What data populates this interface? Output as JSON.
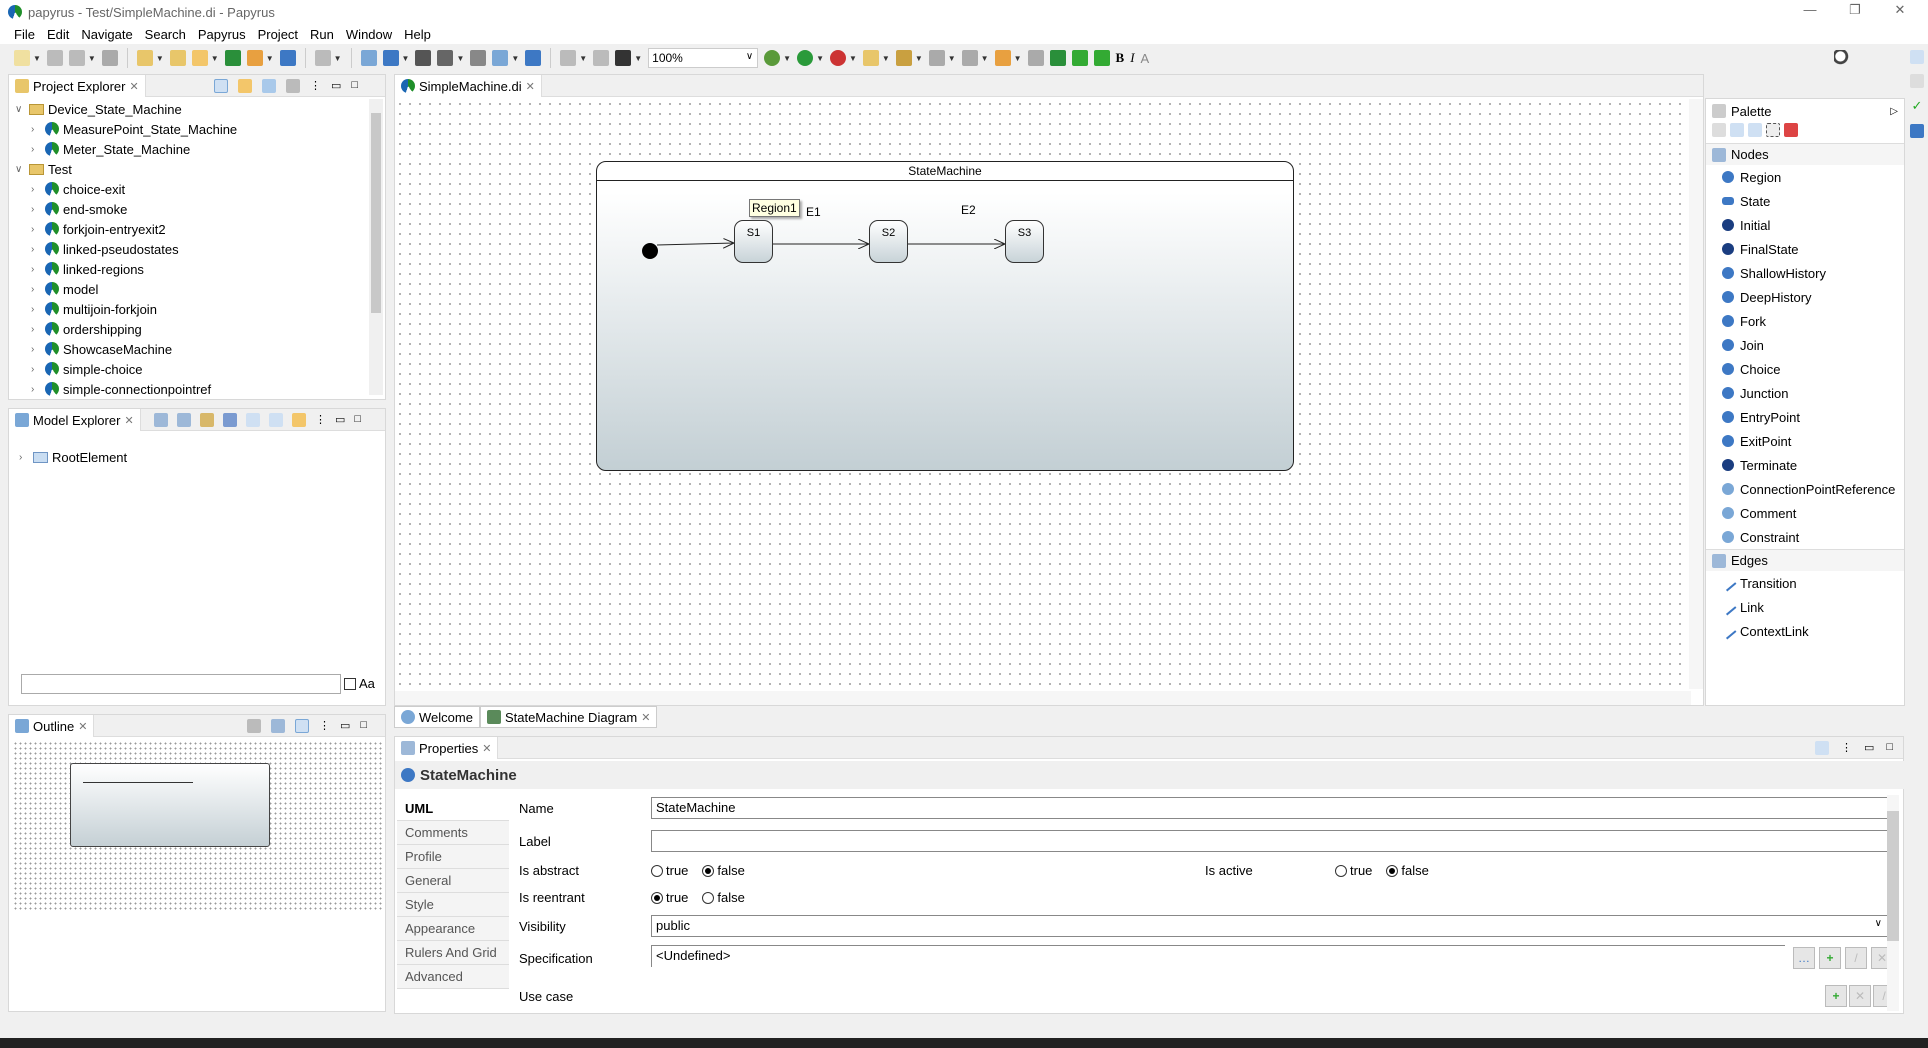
{
  "window": {
    "title": "papyrus - Test/SimpleMachine.di - Papyrus",
    "minimize": "—",
    "restore": "❐",
    "close": "✕"
  },
  "menu": [
    "File",
    "Edit",
    "Navigate",
    "Search",
    "Papyrus",
    "Project",
    "Run",
    "Window",
    "Help"
  ],
  "toolbar": {
    "zoom": "100%",
    "icons": [
      "new-icon",
      "save-icon",
      "save-all-icon",
      "edit-icon",
      "new-diagram-icon",
      "new-table-icon",
      "import-icon",
      "papyrus-icon",
      "sync-icon",
      "arrow-icon",
      "copy-icon",
      "layout-icon",
      "align-icon",
      "distribute-icon",
      "format-icon",
      "select-icon",
      "route-icon",
      "link-icon",
      "snap-icon",
      "grid-icon",
      "fit-icon"
    ],
    "icons2": [
      "debug-icon",
      "run-icon",
      "external-tools-icon",
      "open-icon",
      "search-icon",
      "next-annotation-icon",
      "prev-annotation-icon",
      "back-icon",
      "forward-icon",
      "open-task-icon",
      "nav-back-icon",
      "nav-forward-icon"
    ],
    "bold": "B",
    "italic": "I",
    "font": "A"
  },
  "project_explorer": {
    "title": "Project Explorer",
    "items": [
      {
        "label": "Device_State_Machine",
        "level": 0,
        "expanded": true,
        "kind": "project"
      },
      {
        "label": "MeasurePoint_State_Machine",
        "level": 1,
        "kind": "model"
      },
      {
        "label": "Meter_State_Machine",
        "level": 1,
        "kind": "model"
      },
      {
        "label": "Test",
        "level": 0,
        "expanded": true,
        "kind": "project"
      },
      {
        "label": "choice-exit",
        "level": 1,
        "kind": "model"
      },
      {
        "label": "end-smoke",
        "level": 1,
        "kind": "model"
      },
      {
        "label": "forkjoin-entryexit2",
        "level": 1,
        "kind": "model"
      },
      {
        "label": "linked-pseudostates",
        "level": 1,
        "kind": "model"
      },
      {
        "label": "linked-regions",
        "level": 1,
        "kind": "model"
      },
      {
        "label": "model",
        "level": 1,
        "kind": "model"
      },
      {
        "label": "multijoin-forkjoin",
        "level": 1,
        "kind": "model"
      },
      {
        "label": "ordershipping",
        "level": 1,
        "kind": "model"
      },
      {
        "label": "ShowcaseMachine",
        "level": 1,
        "kind": "model"
      },
      {
        "label": "simple-choice",
        "level": 1,
        "kind": "model"
      },
      {
        "label": "simple-connectionpointref",
        "level": 1,
        "kind": "model"
      }
    ]
  },
  "model_explorer": {
    "title": "Model Explorer",
    "root": "RootElement",
    "filter_value": "",
    "case_label": "Aa"
  },
  "outline": {
    "title": "Outline"
  },
  "editor": {
    "tab": "SimpleMachine.di",
    "bottom_tabs": [
      "Welcome",
      "StateMachine Diagram"
    ],
    "diagram": {
      "state_machine": "StateMachine",
      "states": [
        "S1",
        "S2",
        "S3"
      ],
      "transitions": [
        "E1",
        "E2"
      ],
      "tooltip": "Region1"
    }
  },
  "palette": {
    "title": "Palette",
    "nodes_title": "Nodes",
    "nodes": [
      "Region",
      "State",
      "Initial",
      "FinalState",
      "ShallowHistory",
      "DeepHistory",
      "Fork",
      "Join",
      "Choice",
      "Junction",
      "EntryPoint",
      "ExitPoint",
      "Terminate",
      "ConnectionPointReference",
      "Comment",
      "Constraint"
    ],
    "edges_title": "Edges",
    "edges": [
      "Transition",
      "Link",
      "ContextLink"
    ]
  },
  "properties": {
    "title": "Properties",
    "element": "StateMachine",
    "tabs": [
      "UML",
      "Comments",
      "Profile",
      "General",
      "Style",
      "Appearance",
      "Rulers And Grid",
      "Advanced"
    ],
    "selected_tab": "UML",
    "name_label": "Name",
    "name_value": "StateMachine",
    "label_label": "Label",
    "label_value": "",
    "is_abstract": {
      "label": "Is abstract",
      "value": "false"
    },
    "is_active": {
      "label": "Is active",
      "value": "false"
    },
    "is_reentrant": {
      "label": "Is reentrant",
      "value": "true"
    },
    "true_label": "true",
    "false_label": "false",
    "visibility_label": "Visibility",
    "visibility_value": "public",
    "specification_label": "Specification",
    "specification_value": "<Undefined>",
    "use_case_label": "Use case",
    "more_button": "…"
  }
}
